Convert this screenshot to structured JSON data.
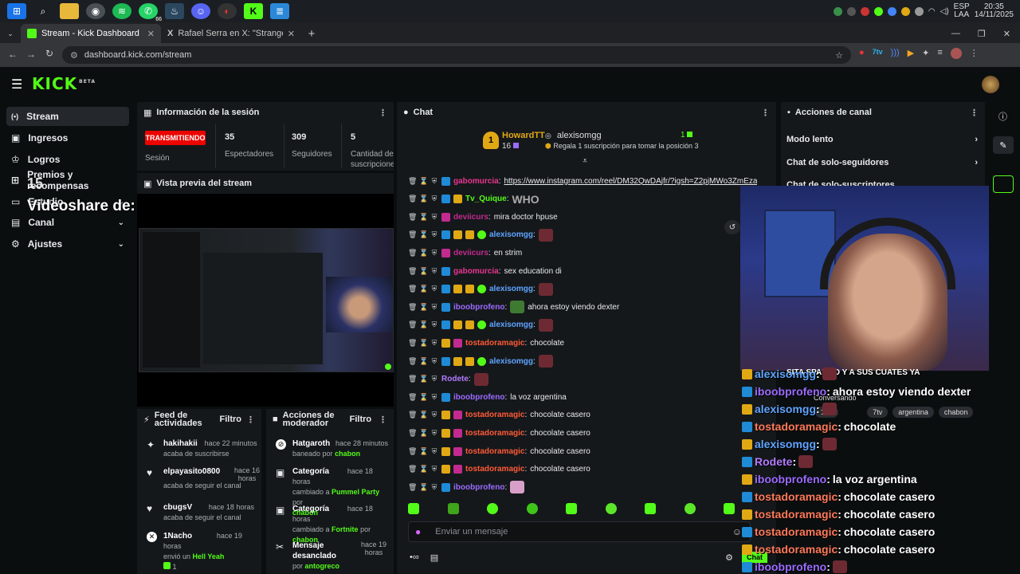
{
  "taskbar": {
    "icons": [
      "windows-icon",
      "search-icon",
      "folder-icon",
      "chrome-icon",
      "spotify-icon",
      "whatsapp-icon",
      "steam-icon",
      "discord-icon",
      "browser-icon",
      "kick-icon",
      "notes-icon"
    ],
    "whatsapp_count": "66",
    "lang": "ESP",
    "lang2": "LAA",
    "time": "20:35",
    "date": "14/11/2025"
  },
  "browser": {
    "tabs": [
      {
        "title": "Stream - Kick Dashboard"
      },
      {
        "title": "Rafael Serra en X: \"Stranger Thi"
      }
    ],
    "url": "dashboard.kick.com/stream"
  },
  "sidebar": {
    "items": [
      {
        "label": "Stream",
        "icon": "broadcast-icon"
      },
      {
        "label": "Ingresos",
        "icon": "money-icon"
      },
      {
        "label": "Logros",
        "icon": "trophy-icon"
      },
      {
        "label": "Premios y recompensas",
        "icon": "gift-icon"
      },
      {
        "label": "Estudio",
        "icon": "studio-icon"
      },
      {
        "label": "Canal",
        "icon": "channel-icon"
      },
      {
        "label": "Ajustes",
        "icon": "settings-icon"
      }
    ],
    "overlay_text": "Videoshare de:",
    "overlay_number": "15"
  },
  "session": {
    "title": "Información de la sesión",
    "live_badge": "TRANSMITIENDO",
    "session_label": "Sesión",
    "stats": [
      {
        "value": "35",
        "label": "Espectadores"
      },
      {
        "value": "309",
        "label": "Seguidores"
      },
      {
        "value": "5",
        "label": "Cantidad de suscripciones"
      }
    ]
  },
  "preview": {
    "title": "Vista previa del stream"
  },
  "feed": {
    "title": "Feed de actividades",
    "filter": "Filtro",
    "items": [
      {
        "user": "hakihakii",
        "time": "hace 22 minutos",
        "text": "acaba de suscribirse",
        "icon": "sparkle-icon"
      },
      {
        "user": "elpayasito0800",
        "time": "hace 16 horas",
        "text": "acaba de seguir el canal",
        "icon": "heart-icon"
      },
      {
        "user": "cbugsV",
        "time": "hace 18 horas",
        "text": "acaba de seguir el canal",
        "icon": "heart-icon"
      },
      {
        "user": "1Nacho",
        "time": "hace 19 horas",
        "text": "envió un",
        "highlight": "Hell Yeah",
        "extra": "1",
        "icon": "kick-gift-icon"
      }
    ]
  },
  "mod": {
    "title": "Acciones de moderador",
    "filter": "Filtro",
    "items": [
      {
        "action": "Hatgaroth",
        "time": "hace 28 minutos",
        "text": "baneado por",
        "by": "chabon",
        "icon": "ban-icon"
      },
      {
        "action": "Categoría",
        "time": "hace 18 horas",
        "text": "cambiado a",
        "target": "Pummel Party",
        "by_prefix": "por",
        "by": "chabon",
        "icon": "category-icon"
      },
      {
        "action": "Categoría",
        "time": "hace 18 horas",
        "text": "cambiado a",
        "target": "Fortnite",
        "by_prefix": "por",
        "by": "chabon",
        "icon": "category-icon"
      },
      {
        "action": "Mensaje desanclado",
        "time": "hace 19 horas",
        "text": "por",
        "by": "antogreco",
        "icon": "unpin-icon"
      }
    ]
  },
  "chat": {
    "title": "Chat",
    "top_gifter": {
      "rank": "1",
      "name": "HowardTT",
      "count": "16"
    },
    "second": {
      "name": "alexisomgg",
      "count": "1",
      "hint": "Regala 1 suscripción para tomar la posición 3"
    },
    "input_placeholder": "Enviar un mensaje",
    "messages": [
      {
        "user": "gabomurcia",
        "color": "#e8368f",
        "text": "https://www.instagram.com/reel/DM32QwDAjfr/?igsh=Z2pjMWo3ZmEzaWM1",
        "link": true,
        "badges": [
          "b-blue"
        ]
      },
      {
        "user": "Tv_Quique",
        "color": "#53fc18",
        "text": "WHO",
        "badges": [
          "b-blue",
          "b-gold"
        ]
      },
      {
        "user": "deviicurs",
        "color": "#c32a8f",
        "text": "mira doctor hpuse",
        "badges": [
          "b-pink"
        ]
      },
      {
        "user": "alexisomgg",
        "color": "#5fa4ff",
        "text": "",
        "emote": "emote",
        "badges": [
          "b-blue",
          "b-gold",
          "b-gold",
          "b-green"
        ]
      },
      {
        "user": "deviicurs",
        "color": "#c32a8f",
        "text": "en strim",
        "badges": [
          "b-pink"
        ]
      },
      {
        "user": "gabomurcia",
        "color": "#e8368f",
        "text": "sex education di",
        "badges": [
          "b-blue"
        ]
      },
      {
        "user": "alexisomgg",
        "color": "#5fa4ff",
        "text": "",
        "emote": "emote",
        "badges": [
          "b-blue",
          "b-gold",
          "b-gold",
          "b-green"
        ]
      },
      {
        "user": "iboobprofeno",
        "color": "#9b6bff",
        "text": "ahora estoy viendo dexter",
        "emote": "emote pepe",
        "badges": [
          "b-blue"
        ]
      },
      {
        "user": "alexisomgg",
        "color": "#5fa4ff",
        "text": "",
        "emote": "emote",
        "badges": [
          "b-blue",
          "b-gold",
          "b-gold",
          "b-green"
        ]
      },
      {
        "user": "tostadoramagic",
        "color": "#ff5a36",
        "text": "chocolate",
        "badges": [
          "b-gold",
          "b-pink"
        ]
      },
      {
        "user": "alexisomgg",
        "color": "#5fa4ff",
        "text": "",
        "emote": "emote",
        "badges": [
          "b-blue",
          "b-gold",
          "b-gold",
          "b-green"
        ]
      },
      {
        "user": "Rodete",
        "color": "#b37bff",
        "text": "",
        "emote": "emote",
        "badges": []
      },
      {
        "user": "iboobprofeno",
        "color": "#9b6bff",
        "text": "la voz argentina",
        "badges": [
          "b-blue"
        ]
      },
      {
        "user": "tostadoramagic",
        "color": "#ff5a36",
        "text": "chocolate casero",
        "badges": [
          "b-gold",
          "b-pink"
        ]
      },
      {
        "user": "tostadoramagic",
        "color": "#ff5a36",
        "text": "chocolate casero",
        "badges": [
          "b-gold",
          "b-pink"
        ]
      },
      {
        "user": "tostadoramagic",
        "color": "#ff5a36",
        "text": "chocolate casero",
        "badges": [
          "b-gold",
          "b-pink"
        ]
      },
      {
        "user": "tostadoramagic",
        "color": "#ff5a36",
        "text": "chocolate casero",
        "badges": [
          "b-gold",
          "b-pink"
        ]
      },
      {
        "user": "iboobprofeno",
        "color": "#9b6bff",
        "text": "",
        "emote": "emote pink",
        "badges": [
          "b-blue"
        ]
      }
    ]
  },
  "channel_actions": {
    "title": "Acciones de canal",
    "items": [
      {
        "label": "Modo lento"
      },
      {
        "label": "Chat de solo-seguidores"
      },
      {
        "label": "Chat de solo-suscriptores"
      }
    ]
  },
  "overlay": {
    "spam_text": "SITA SPAMEO Y A SUS CUATES YA",
    "conversando": "Conversando",
    "tags": [
      "18+",
      "7tv",
      "argentina",
      "chabon"
    ],
    "chat_label": "Chat",
    "rows": [
      {
        "user": "alexisomgg",
        "color": "#5fa4ff",
        "text": ""
      },
      {
        "user": "iboobprofeno",
        "color": "#9b6bff",
        "text": "ahora estoy viendo dexter"
      },
      {
        "user": "alexisomgg",
        "color": "#5fa4ff",
        "text": ""
      },
      {
        "user": "tostadoramagic",
        "color": "#ff7a5a",
        "text": "chocolate"
      },
      {
        "user": "alexisomgg",
        "color": "#5fa4ff",
        "text": ""
      },
      {
        "user": "Rodete",
        "color": "#b37bff",
        "text": ""
      },
      {
        "user": "iboobprofeno",
        "color": "#9b6bff",
        "text": "la voz argentina"
      },
      {
        "user": "tostadoramagic",
        "color": "#ff7a5a",
        "text": "chocolate casero"
      },
      {
        "user": "tostadoramagic",
        "color": "#ff7a5a",
        "text": "chocolate casero"
      },
      {
        "user": "tostadoramagic",
        "color": "#ff7a5a",
        "text": "chocolate casero"
      },
      {
        "user": "tostadoramagic",
        "color": "#ff7a5a",
        "text": "chocolate casero"
      },
      {
        "user": "iboobprofeno",
        "color": "#9b6bff",
        "text": ""
      }
    ]
  },
  "colors": {
    "brand": "#53fc18",
    "live": "#eb0400",
    "panel": "#15181b",
    "bg": "#0b0e0f"
  }
}
